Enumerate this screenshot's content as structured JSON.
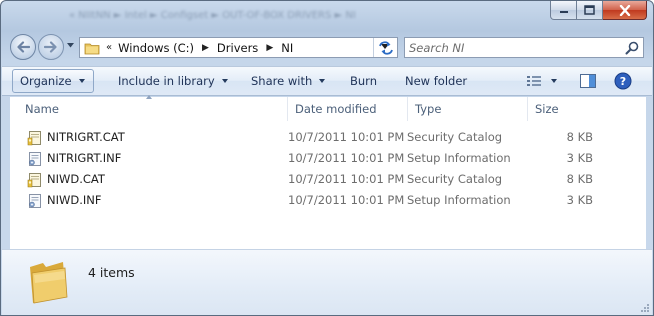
{
  "window": {
    "title_blurred": "« NIItNN ► Intel ► Configset ► OUT-OF-BOX DRIVERS ► NI",
    "caption": {
      "minimize": "minimize",
      "maximize": "maximize",
      "close": "close"
    }
  },
  "address": {
    "overflow_chevron": "«",
    "crumbs": [
      "Windows (C:)",
      "Drivers",
      "NI"
    ]
  },
  "search": {
    "placeholder": "Search NI"
  },
  "toolbar": {
    "organize": "Organize",
    "include_in_library": "Include in library",
    "share_with": "Share with",
    "burn": "Burn",
    "new_folder": "New folder"
  },
  "columns": {
    "name": "Name",
    "date": "Date modified",
    "type": "Type",
    "size": "Size"
  },
  "files": [
    {
      "name": "NITRIGRT.CAT",
      "date": "10/7/2011 10:01 PM",
      "type": "Security Catalog",
      "size": "8 KB",
      "icon": "security-catalog-icon"
    },
    {
      "name": "NITRIGRT.INF",
      "date": "10/7/2011 10:01 PM",
      "type": "Setup Information",
      "size": "3 KB",
      "icon": "setup-information-icon"
    },
    {
      "name": "NIWD.CAT",
      "date": "10/7/2011 10:01 PM",
      "type": "Security Catalog",
      "size": "8 KB",
      "icon": "security-catalog-icon"
    },
    {
      "name": "NIWD.INF",
      "date": "10/7/2011 10:01 PM",
      "type": "Setup Information",
      "size": "3 KB",
      "icon": "setup-information-icon"
    }
  ],
  "details": {
    "item_count": "4 items"
  },
  "colors": {
    "accent": "#1e3257",
    "secondary_text": "#6d6d6d",
    "header_text": "#4c607a"
  }
}
